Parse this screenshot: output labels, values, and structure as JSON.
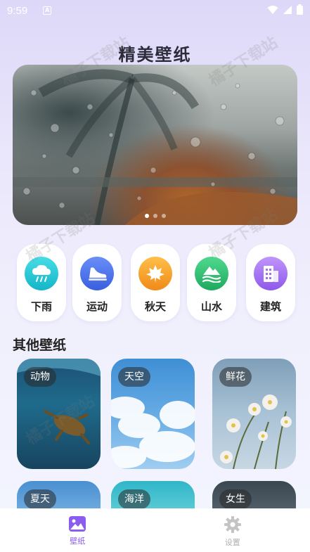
{
  "status_bar": {
    "time": "9:59",
    "notif": "A"
  },
  "app_title": "精美壁纸",
  "banner": {
    "dots": 3,
    "active_dot": 0
  },
  "categories": [
    {
      "label": "下雨",
      "icon": "rain-cloud-icon",
      "color": "#27c9d6"
    },
    {
      "label": "运动",
      "icon": "sneaker-icon",
      "color": "#4a7cf0"
    },
    {
      "label": "秋天",
      "icon": "maple-leaf-icon",
      "color": "#f5a12a"
    },
    {
      "label": "山水",
      "icon": "mountain-water-icon",
      "color": "#2fbf73"
    },
    {
      "label": "建筑",
      "icon": "building-icon",
      "color": "#a36ef0"
    }
  ],
  "section_title": "其他壁纸",
  "wallpapers": [
    {
      "tag": "动物"
    },
    {
      "tag": "天空"
    },
    {
      "tag": "鲜花"
    },
    {
      "tag": "夏天"
    },
    {
      "tag": "海洋"
    },
    {
      "tag": "女生"
    }
  ],
  "tabbar": {
    "tabs": [
      {
        "label": "壁纸",
        "icon": "image-icon",
        "active": true
      },
      {
        "label": "设置",
        "icon": "gear-icon",
        "active": false
      }
    ],
    "active_color": "#8a5cf0",
    "inactive_color": "#b0b0b0"
  },
  "watermark_text": "橘子下载站"
}
